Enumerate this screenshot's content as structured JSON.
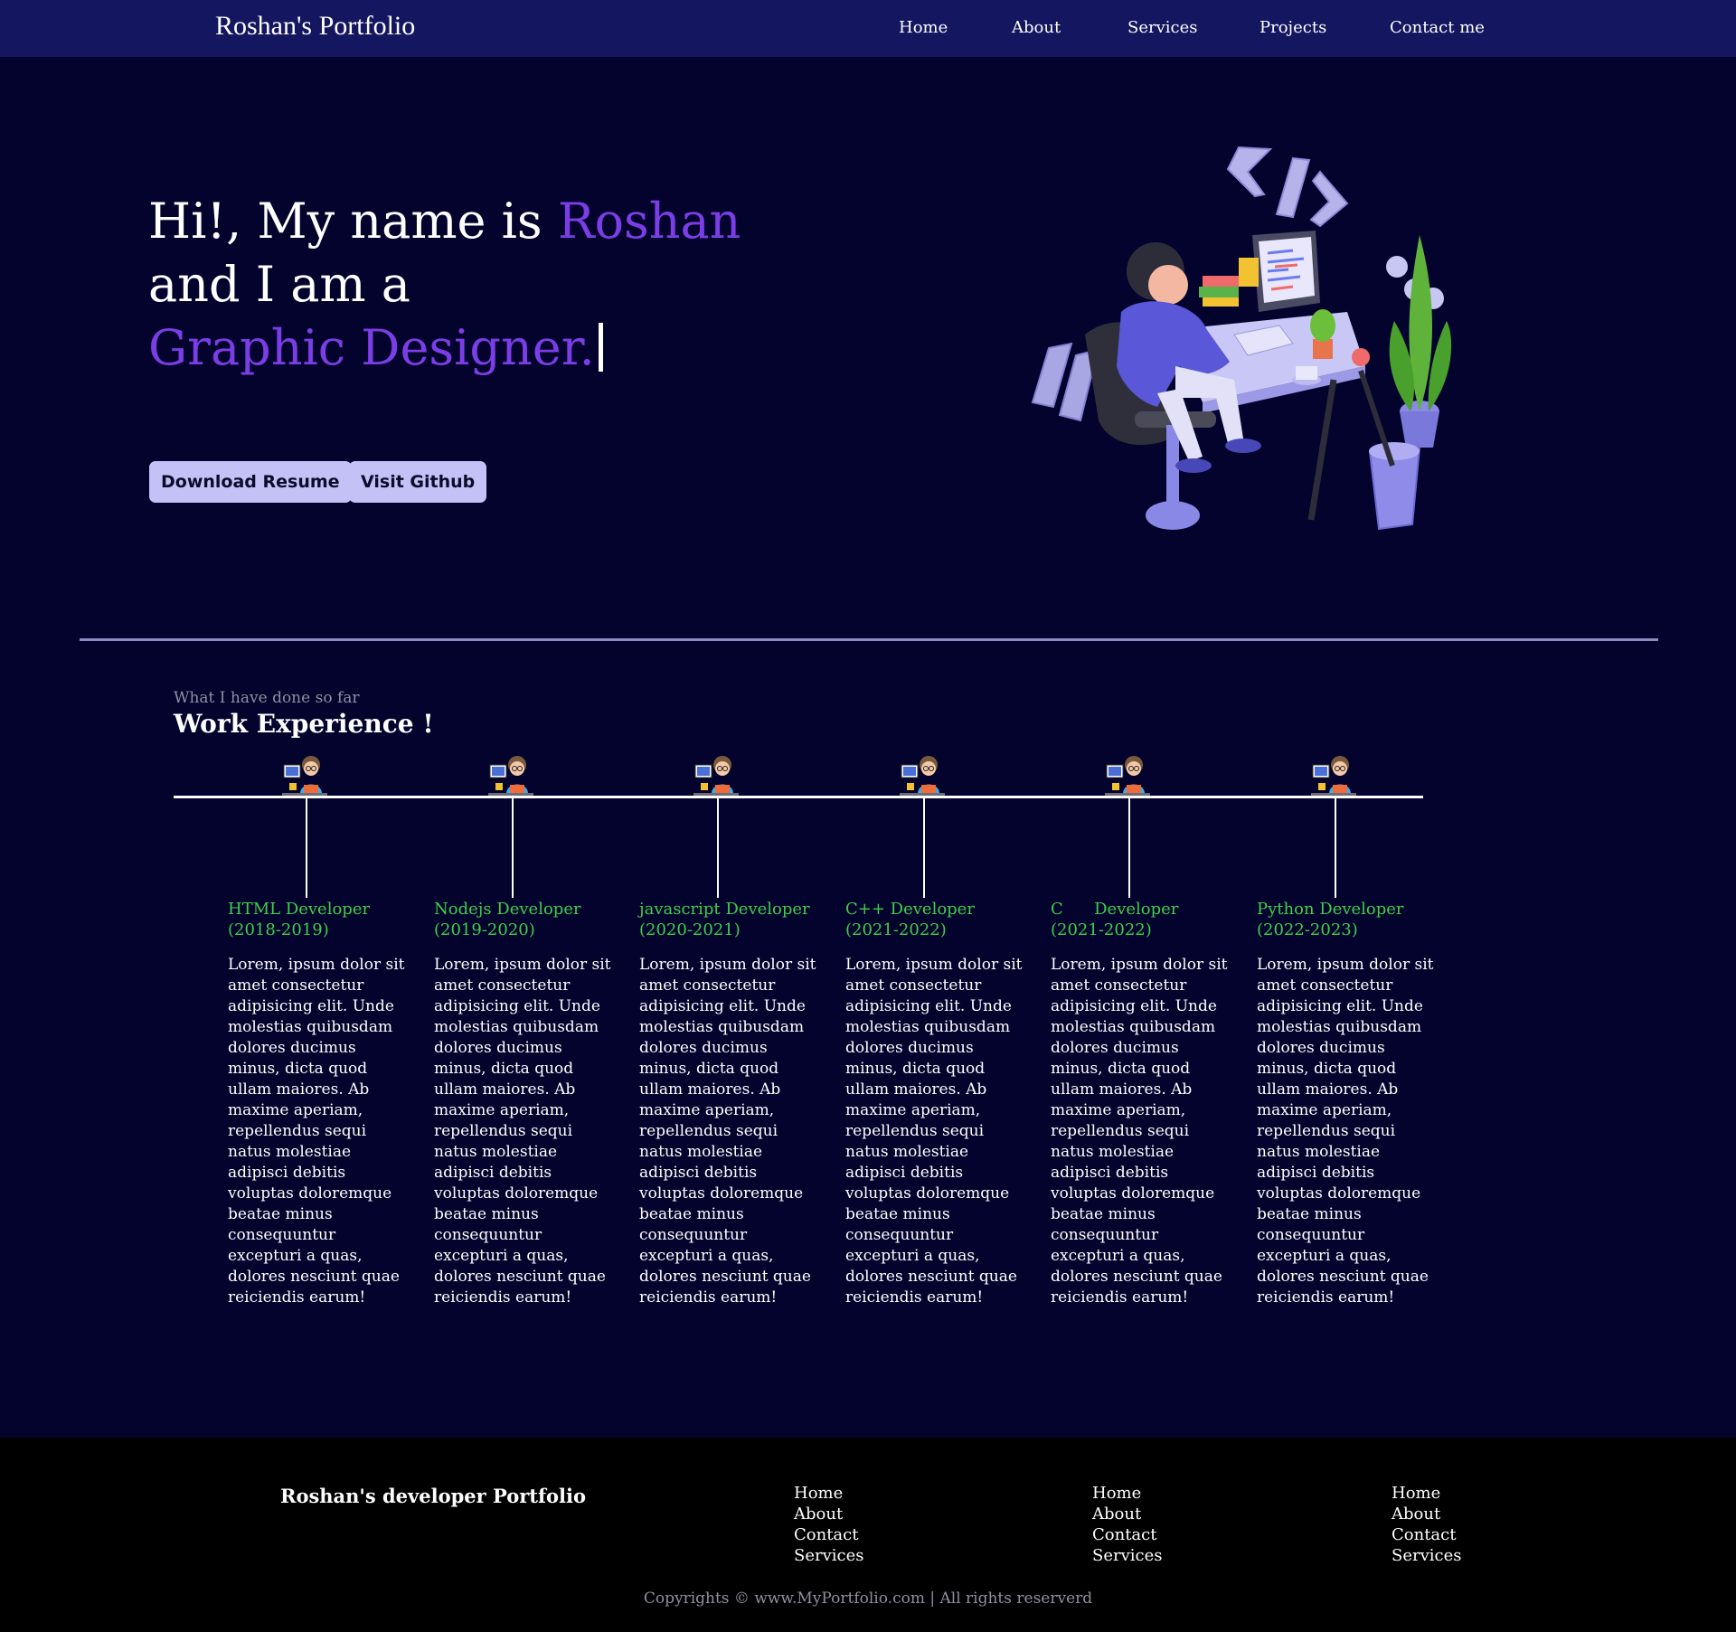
{
  "nav": {
    "brand": "Roshan's Portfolio",
    "links": [
      "Home",
      "About",
      "Services",
      "Projects",
      "Contact me"
    ]
  },
  "hero": {
    "line1_prefix": "Hi!, My name is",
    "line1_name": "Roshan",
    "line2": "and I am a",
    "line3_role": "Graphic Designer.",
    "buttons": {
      "resume": "Download Resume",
      "github": "Visit Github"
    }
  },
  "work": {
    "subtitle": "What I have done so far",
    "title": "Work Experience !",
    "jobs": [
      {
        "title": "HTML Developer",
        "years": "(2018-2019)"
      },
      {
        "title": "Nodejs Developer",
        "years": "(2019-2020)"
      },
      {
        "title": "javascript Developer",
        "years": "(2020-2021)"
      },
      {
        "title": "C++ Developer",
        "years": "(2021-2022)"
      },
      {
        "title": "C      Developer",
        "years": "(2021-2022)"
      },
      {
        "title": "Python Developer",
        "years": "(2022-2023)"
      }
    ],
    "description": "Lorem, ipsum dolor sit amet consectetur adipisicing elit. Unde molestias quibusdam dolores ducimus minus, dicta quod ullam maiores. Ab maxime aperiam, repellendus sequi natus molestiae adipisci debitis voluptas doloremque beatae minus consequuntur excepturi a quas, dolores nesciunt quae reiciendis earum!"
  },
  "footer": {
    "brand": "Roshan's developer Portfolio",
    "columns": [
      [
        "Home",
        "About",
        "Contact",
        "Services"
      ],
      [
        "Home",
        "About",
        "Contact",
        "Services"
      ],
      [
        "Home",
        "About",
        "Contact",
        "Services"
      ]
    ],
    "copyright": "Copyrights © www.MyPortfolio.com | All rights reserverd"
  },
  "colors": {
    "background": "#03032d",
    "nav": "#141660",
    "accent": "#7b3ee6",
    "button": "#c4c1f7",
    "job_title": "#3fcf4b",
    "footer": "#000000"
  },
  "icons": [
    "developer-illustration",
    "developer-avatar-icon"
  ]
}
